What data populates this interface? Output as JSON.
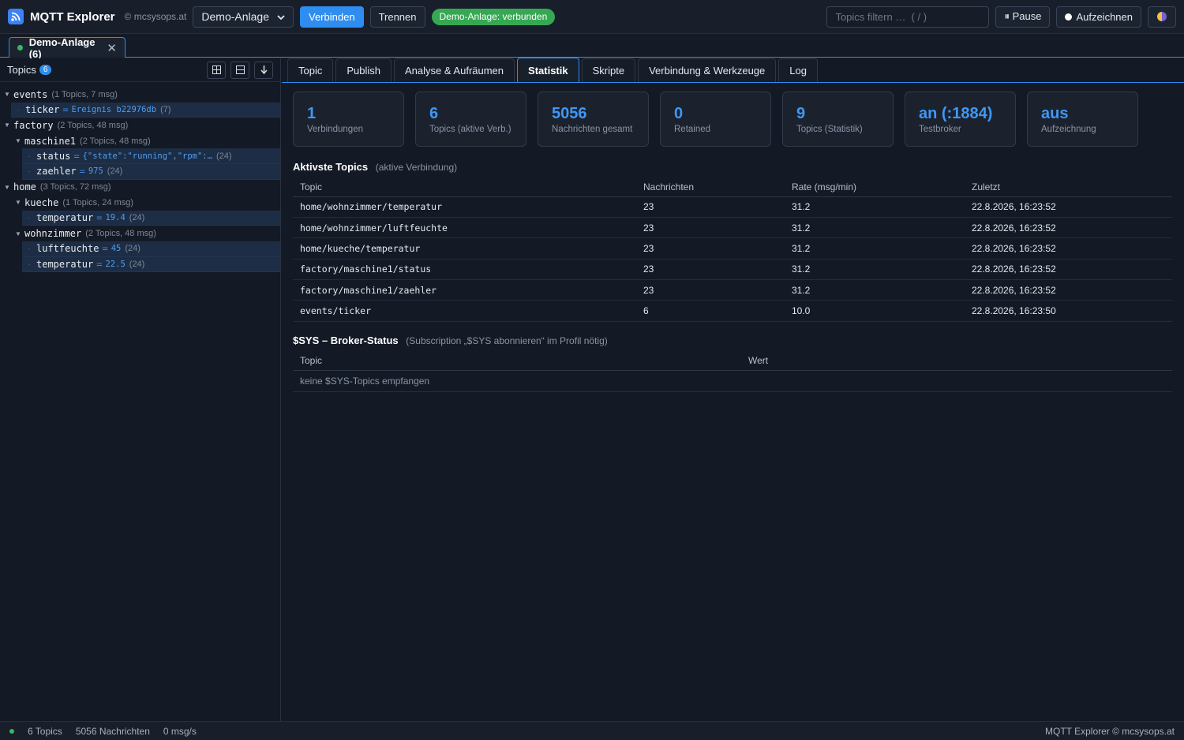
{
  "app": {
    "title": "MQTT Explorer",
    "copyright": "© mcsysops.at"
  },
  "topbar": {
    "profile_select": "Demo-Anlage",
    "connect_label": "Verbinden",
    "disconnect_label": "Trennen",
    "status_pill": "Demo-Anlage: verbunden",
    "filter_placeholder": "Topics filtern …  ( / )",
    "pause_label": "⏸ Pause",
    "record_label": "Aufzeichnen"
  },
  "connection_tab": {
    "label": "Demo-Anlage (6)"
  },
  "sidebar": {
    "title": "Topics",
    "count": "6",
    "tree": [
      {
        "level": 0,
        "name": "events",
        "meta": "(1 Topics, 7 msg)"
      },
      {
        "level": 1,
        "leaf": true,
        "name": "ticker",
        "value": "Ereignis b22976db",
        "meta": "(7)"
      },
      {
        "level": 0,
        "name": "factory",
        "meta": "(2 Topics, 48 msg)"
      },
      {
        "level": 1,
        "name": "maschine1",
        "meta": "(2 Topics, 48 msg)"
      },
      {
        "level": 2,
        "leaf": true,
        "name": "status",
        "value": "{\"state\":\"running\",\"rpm\":…",
        "meta": "(24)"
      },
      {
        "level": 2,
        "leaf": true,
        "name": "zaehler",
        "value": "975",
        "meta": "(24)"
      },
      {
        "level": 0,
        "name": "home",
        "meta": "(3 Topics, 72 msg)"
      },
      {
        "level": 1,
        "name": "kueche",
        "meta": "(1 Topics, 24 msg)"
      },
      {
        "level": 2,
        "leaf": true,
        "name": "temperatur",
        "value": "19.4",
        "meta": "(24)"
      },
      {
        "level": 1,
        "name": "wohnzimmer",
        "meta": "(2 Topics, 48 msg)"
      },
      {
        "level": 2,
        "leaf": true,
        "name": "luftfeuchte",
        "value": "45",
        "meta": "(24)"
      },
      {
        "level": 2,
        "leaf": true,
        "name": "temperatur",
        "value": "22.5",
        "meta": "(24)"
      }
    ]
  },
  "main": {
    "tabs": [
      {
        "label": "Topic",
        "active": false
      },
      {
        "label": "Publish",
        "active": false
      },
      {
        "label": "Analyse & Aufräumen",
        "active": false
      },
      {
        "label": "Statistik",
        "active": true
      },
      {
        "label": "Skripte",
        "active": false
      },
      {
        "label": "Verbindung & Werkzeuge",
        "active": false
      },
      {
        "label": "Log",
        "active": false
      }
    ],
    "stats": [
      {
        "value": "1",
        "label": "Verbindungen"
      },
      {
        "value": "6",
        "label": "Topics (aktive Verb.)"
      },
      {
        "value": "5056",
        "label": "Nachrichten gesamt"
      },
      {
        "value": "0",
        "label": "Retained"
      },
      {
        "value": "9",
        "label": "Topics (Statistik)"
      },
      {
        "value": "an (:1884)",
        "label": "Testbroker"
      },
      {
        "value": "aus",
        "label": "Aufzeichnung"
      }
    ],
    "active_topics": {
      "title": "Aktivste Topics",
      "subtitle": "(aktive Verbindung)",
      "columns": [
        "Topic",
        "Nachrichten",
        "Rate (msg/min)",
        "Zuletzt"
      ],
      "rows": [
        [
          "home/wohnzimmer/temperatur",
          "23",
          "31.2",
          "22.8.2026, 16:23:52"
        ],
        [
          "home/wohnzimmer/luftfeuchte",
          "23",
          "31.2",
          "22.8.2026, 16:23:52"
        ],
        [
          "home/kueche/temperatur",
          "23",
          "31.2",
          "22.8.2026, 16:23:52"
        ],
        [
          "factory/maschine1/status",
          "23",
          "31.2",
          "22.8.2026, 16:23:52"
        ],
        [
          "factory/maschine1/zaehler",
          "23",
          "31.2",
          "22.8.2026, 16:23:52"
        ],
        [
          "events/ticker",
          "6",
          "10.0",
          "22.8.2026, 16:23:50"
        ]
      ]
    },
    "sys_status": {
      "title": "$SYS – Broker-Status",
      "subtitle": "(Subscription „$SYS abonnieren“ im Profil nötig)",
      "columns": [
        "Topic",
        "Wert"
      ],
      "empty": "keine $SYS-Topics empfangen"
    }
  },
  "statusbar": {
    "topics": "6 Topics",
    "messages": "5056 Nachrichten",
    "rate": "0 msg/s",
    "right": "MQTT Explorer © mcsysops.at"
  },
  "colors": {
    "accent": "#2f8df0",
    "connected": "#36a853",
    "background": "#141a25"
  }
}
